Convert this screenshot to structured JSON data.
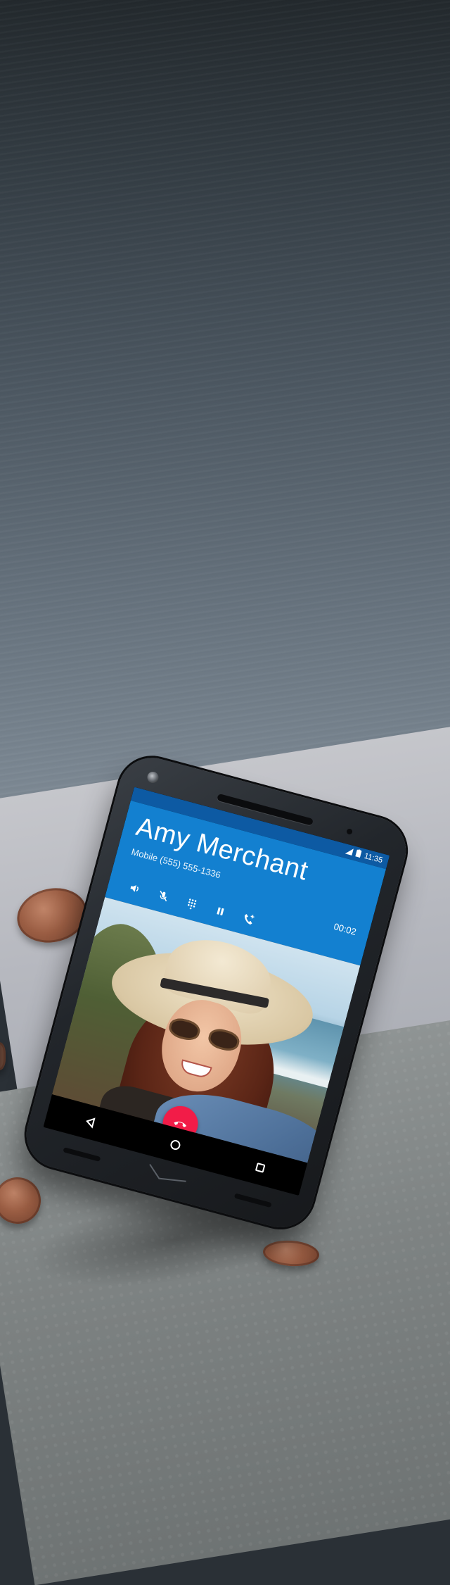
{
  "status": {
    "time": "11:35",
    "icons": [
      "signal-icon",
      "battery-icon"
    ]
  },
  "call": {
    "caller_name": "Amy Merchant",
    "caller_number": "Mobile (555) 555-1336",
    "timer": "00:02",
    "controls": [
      "speaker-icon",
      "mute-icon",
      "dialpad-icon",
      "hold-icon",
      "add-call-icon"
    ],
    "end_call_icon": "end-call-icon",
    "accent_color": "#1380d0",
    "end_call_color": "#f21c48"
  },
  "navbar": {
    "buttons": [
      "back-icon",
      "home-icon",
      "recents-icon"
    ]
  }
}
